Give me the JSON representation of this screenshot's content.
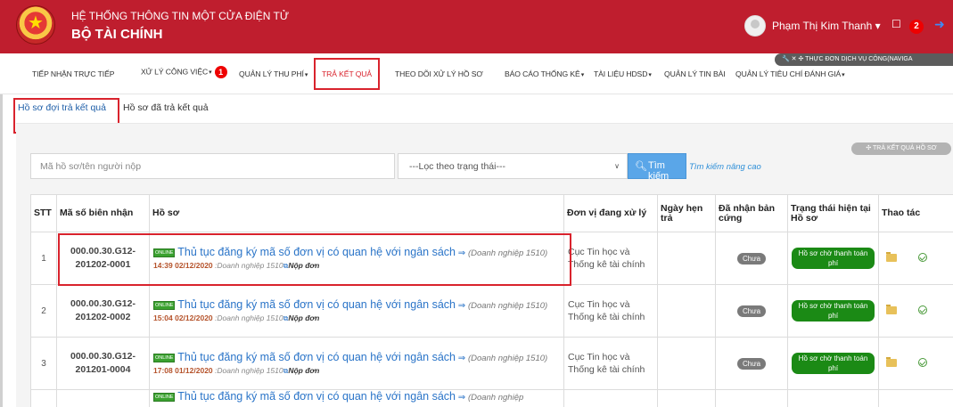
{
  "header": {
    "title_line1": "HỆ THỐNG THÔNG TIN MỘT CỬA ĐIỆN TỬ",
    "title_line2": "BỘ TÀI CHÍNH",
    "user_name": "Phạm Thị Kim Thanh",
    "notification_count": "2",
    "icons": [
      "emblem-logo",
      "user-avatar",
      "bell-icon",
      "logout-icon"
    ]
  },
  "nav": {
    "items": [
      {
        "label": "TIẾP NHẬN TRỰC TIẾP",
        "dropdown": false
      },
      {
        "label": "XỬ LÝ CÔNG VIỆC",
        "dropdown": true,
        "badge": "1"
      },
      {
        "label": "QUẢN LÝ THU PHÍ",
        "dropdown": true
      },
      {
        "label": "TRẢ KẾT QUẢ",
        "dropdown": false,
        "active": true
      },
      {
        "label": "THEO DÕI XỬ LÝ HỒ SƠ",
        "dropdown": false
      },
      {
        "label": "BÁO CÁO THỐNG KÊ",
        "dropdown": true
      },
      {
        "label": "TÀI LIỆU HDSD",
        "dropdown": true
      },
      {
        "label": "QUẢN LÝ TIN BÀI",
        "dropdown": false
      },
      {
        "label": "QUẢN LÝ TIÊU CHÍ ĐÁNH GIÁ",
        "dropdown": true
      }
    ],
    "service_menu": "✕ ✣ THỰC ĐƠN DỊCH VỤ CÔNG(NAVIGA"
  },
  "subtabs": {
    "pending": "Hồ sơ đợi trả kết quả",
    "returned": "Hồ sơ đã trả kết quả"
  },
  "toolbar": {
    "export_label": "✣ TRẢ KẾT QUẢ HỒ SƠ",
    "search_placeholder": "Mã hồ sơ/tên người nộp",
    "status_filter": "---Lọc theo trạng thái---",
    "search_button": "Tìm kiếm",
    "advanced_link": "Tìm kiếm nâng cao"
  },
  "table": {
    "headers": {
      "stt": "STT",
      "code": "Mã số biên nhận",
      "record": "Hồ sơ",
      "unit": "Đơn vị đang xử lý",
      "due": "Ngày hẹn trả",
      "received": "Đã nhận bản cứng",
      "status": "Trạng thái hiện tại Hồ sơ",
      "actions": "Thao tác"
    },
    "rows": [
      {
        "stt": "1",
        "code_a": "000.00.30.G12-",
        "code_b": "201202-0001",
        "online": "ONLINE",
        "procedure": "Thủ tục đăng ký mã số đơn vị có quan hệ với ngân sách",
        "enterprise": "(Doanh nghiệp 1510)",
        "time": "14:39 02/12/2020",
        "by": ":Doanh nghiệp 1510",
        "action": "Nộp đơn",
        "unit": "Cục Tin học và Thống kê tài chính",
        "due": "",
        "received": "Chưa",
        "status": "Hồ sơ chờ thanh toán phí"
      },
      {
        "stt": "2",
        "code_a": "000.00.30.G12-",
        "code_b": "201202-0002",
        "online": "ONLINE",
        "procedure": "Thủ tục đăng ký mã số đơn vị có quan hệ với ngân sách",
        "enterprise": "(Doanh nghiệp 1510)",
        "time": "15:04 02/12/2020",
        "by": ":Doanh nghiệp 1510",
        "action": "Nộp đơn",
        "unit": "Cục Tin học và Thống kê tài chính",
        "due": "",
        "received": "Chưa",
        "status": "Hồ sơ chờ thanh toán phí"
      },
      {
        "stt": "3",
        "code_a": "000.00.30.G12-",
        "code_b": "201201-0004",
        "online": "ONLINE",
        "procedure": "Thủ tục đăng ký mã số đơn vị có quan hệ với ngân sách",
        "enterprise": "(Doanh nghiệp 1510)",
        "time": "17:08 01/12/2020",
        "by": ":Doanh nghiệp 1510",
        "action": "Nộp đơn",
        "unit": "Cục Tin học và Thống kê tài chính",
        "due": "",
        "received": "Chưa",
        "status": "Hồ sơ chờ thanh toán phí"
      },
      {
        "online": "ONLINE",
        "procedure": "Thủ tục đăng ký mã số đơn vị có quan hệ với ngân sách",
        "enterprise": "(Doanh nghiệp"
      }
    ]
  },
  "colors": {
    "header_bg": "#bf1e2e",
    "highlight": "#d9232d",
    "link": "#2a74c8",
    "status_green": "#1b8a15",
    "search_button": "#5aa6e8"
  }
}
